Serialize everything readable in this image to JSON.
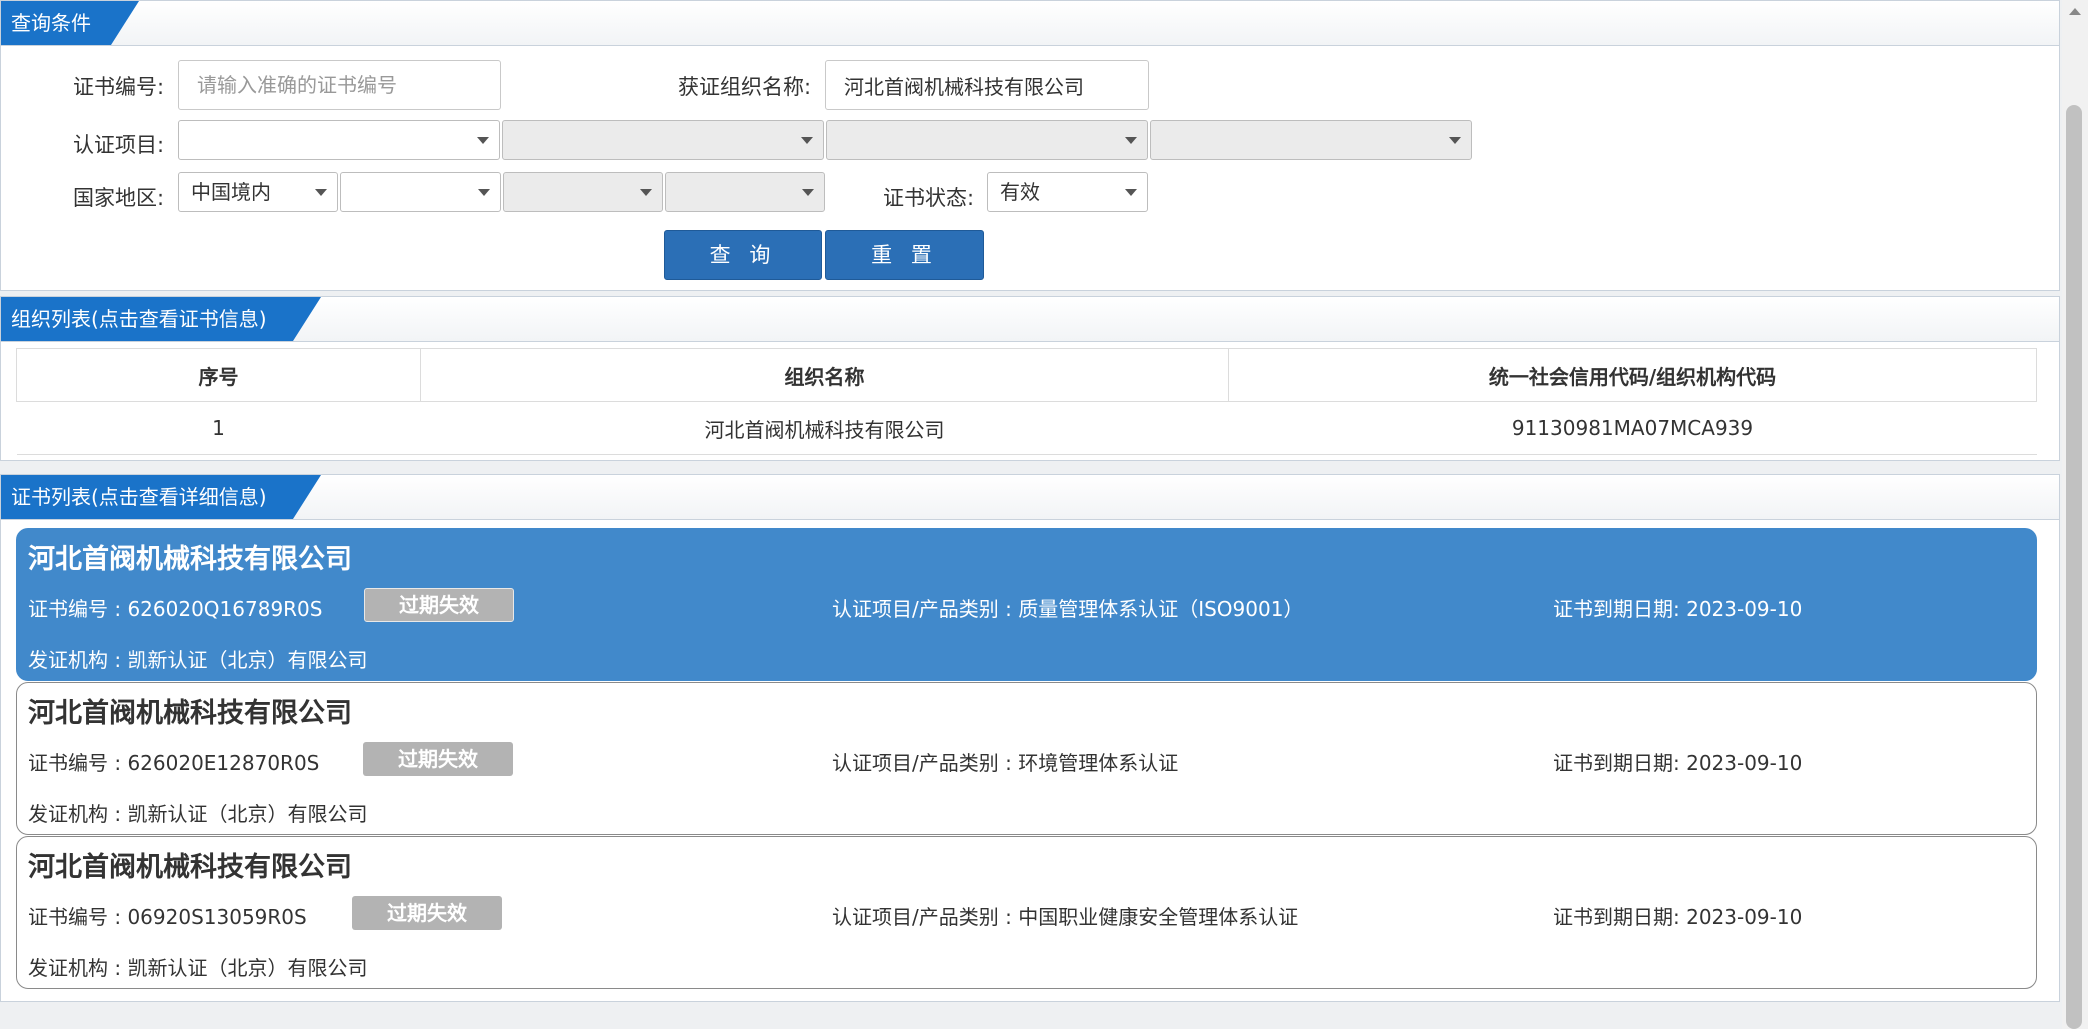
{
  "query": {
    "tab": "查询条件",
    "cert_no": {
      "label": "证书编号:",
      "placeholder": "请输入准确的证书编号",
      "value": ""
    },
    "org_name": {
      "label": "获证组织名称:",
      "value": "河北首阀机械科技有限公司"
    },
    "cert_item": {
      "label": "认证项目:",
      "selects": [
        "",
        "",
        "",
        ""
      ]
    },
    "region": {
      "label": "国家地区:",
      "selects": [
        "中国境内",
        "",
        "",
        ""
      ]
    },
    "status": {
      "label": "证书状态:",
      "value": "有效"
    },
    "buttons": {
      "search": "查 询",
      "reset": "重 置"
    }
  },
  "org_list": {
    "tab": "组织列表(点击查看证书信息)",
    "columns": [
      "序号",
      "组织名称",
      "统一社会信用代码/组织机构代码"
    ],
    "rows": [
      [
        "1",
        "河北首阀机械科技有限公司",
        "91130981MA07MCA939"
      ]
    ]
  },
  "cert_list": {
    "tab": "证书列表(点击查看详细信息)",
    "cards": [
      {
        "title": "河北首阀机械科技有限公司",
        "cert_no": "证书编号 : 626020Q16789R0S",
        "badge": "过期失效",
        "item": "认证项目/产品类别 : 质量管理体系认证（ISO9001）",
        "expiry": "证书到期日期: 2023-09-10",
        "issuer": "发证机构 : 凯新认证（北京）有限公司"
      },
      {
        "title": "河北首阀机械科技有限公司",
        "cert_no": "证书编号 : 626020E12870R0S",
        "badge": "过期失效",
        "item": "认证项目/产品类别 : 环境管理体系认证",
        "expiry": "证书到期日期: 2023-09-10",
        "issuer": "发证机构 : 凯新认证（北京）有限公司"
      },
      {
        "title": "河北首阀机械科技有限公司",
        "cert_no": "证书编号 : 06920S13059R0S",
        "badge": "过期失效",
        "item": "认证项目/产品类别 : 中国职业健康安全管理体系认证",
        "expiry": "证书到期日期: 2023-09-10",
        "issuer": "发证机构 : 凯新认证（北京）有限公司"
      }
    ]
  },
  "colors": {
    "tab_blue": "#1a73c9",
    "button_blue": "#2b6fb6",
    "active_card": "#4189cb",
    "badge_gray": "#b3b3b3"
  }
}
